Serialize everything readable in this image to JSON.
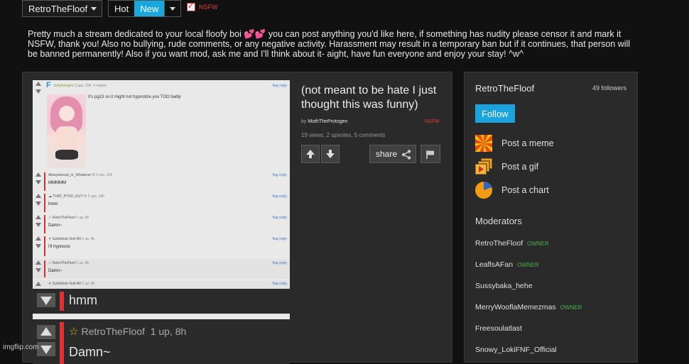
{
  "topbar": {
    "stream_name": "RetroTheFloof",
    "sort_hot": "Hot",
    "sort_new": "New",
    "nsfw_label": "NSFW"
  },
  "description": "Pretty much a stream dedicated to your local floofy boi 💕💕 you can post anything you'd like here, if something has nudity please censor it and mark it NSFW, thank you! Also no bullying, rude comments, or any negative activity. Harassment may result in a temporary ban but if it continues, that person will be banned permanently! Also if you want mod, ask me and I'll think about it- aight, have fun everyone and enjoy your stay! ^w^",
  "post": {
    "title": "(not meant to be hate I just thought this was funny)",
    "by_prefix": "by",
    "author": "MothTheProtogen",
    "nsfw": "NSFW",
    "stats": "19 views, 2 upvotes, 5 comments",
    "share_label": "share"
  },
  "image_comments": {
    "first": {
      "letter": "F",
      "user": "furbyhangirk",
      "meta": "3 ups, 20h, 4 replies",
      "text": "It's pg13 so it might not hypnotize you TOO badly",
      "flag": "flag reply"
    },
    "replies": [
      {
        "user": "Alwaysbread_or_Whatever",
        "meta": "M 3 ups, 20h",
        "text": "MMMMM",
        "flag": "flag reply"
      },
      {
        "user": "☁ THAT_PTSD_GUY",
        "meta": "M 2 ups, 18h",
        "text": "hmm",
        "flag": "flag reply"
      },
      {
        "user": "☆ RetroTheFloof",
        "meta": "1 up, 8h",
        "text": "Damn~",
        "flag": "flag reply"
      },
      {
        "user": "✦ Substitute-Goil-Alt",
        "meta": "1 up, 8h",
        "text": "I'll hypnosis",
        "flag": "flag reply"
      }
    ],
    "zoom1": {
      "user": "☆ RetroTheFloof",
      "meta": "1 up, 8h",
      "text": "Damn~",
      "flag": "flag reply"
    },
    "zoom2": {
      "user": "✦ Substitute-Goil-Alt",
      "meta": "1 up, 8h",
      "flag": "flag reply"
    },
    "big_hmm": "hmm",
    "big_user": "RetroTheFloof",
    "big_meta": "1 up, 8h",
    "big_damn": "Damn~"
  },
  "sidebar": {
    "name": "RetroTheFloof",
    "followers": "49 followers",
    "follow_label": "Follow",
    "actions": [
      {
        "label": "Post a meme",
        "icon": "meme-icon"
      },
      {
        "label": "Post a gif",
        "icon": "gif-icon"
      },
      {
        "label": "Post a chart",
        "icon": "chart-icon"
      }
    ],
    "moderators_title": "Moderators",
    "moderators": [
      {
        "name": "RetroTheFloof",
        "badge": "OWNER"
      },
      {
        "name": "LeaflsAFan",
        "badge": "OWNER"
      },
      {
        "name": "Sussybaka_hehe",
        "badge": ""
      },
      {
        "name": "MerryWooflaMemezmas",
        "badge": "OWNER"
      },
      {
        "name": "Freesoulatlast",
        "badge": ""
      },
      {
        "name": "Snowy_LokiFNF_Official",
        "badge": ""
      }
    ]
  },
  "watermark": "imgflip.com",
  "colors": {
    "accent": "#19a7e0",
    "nsfw": "#e04040",
    "owner": "#4caf50",
    "background": "#111111"
  }
}
